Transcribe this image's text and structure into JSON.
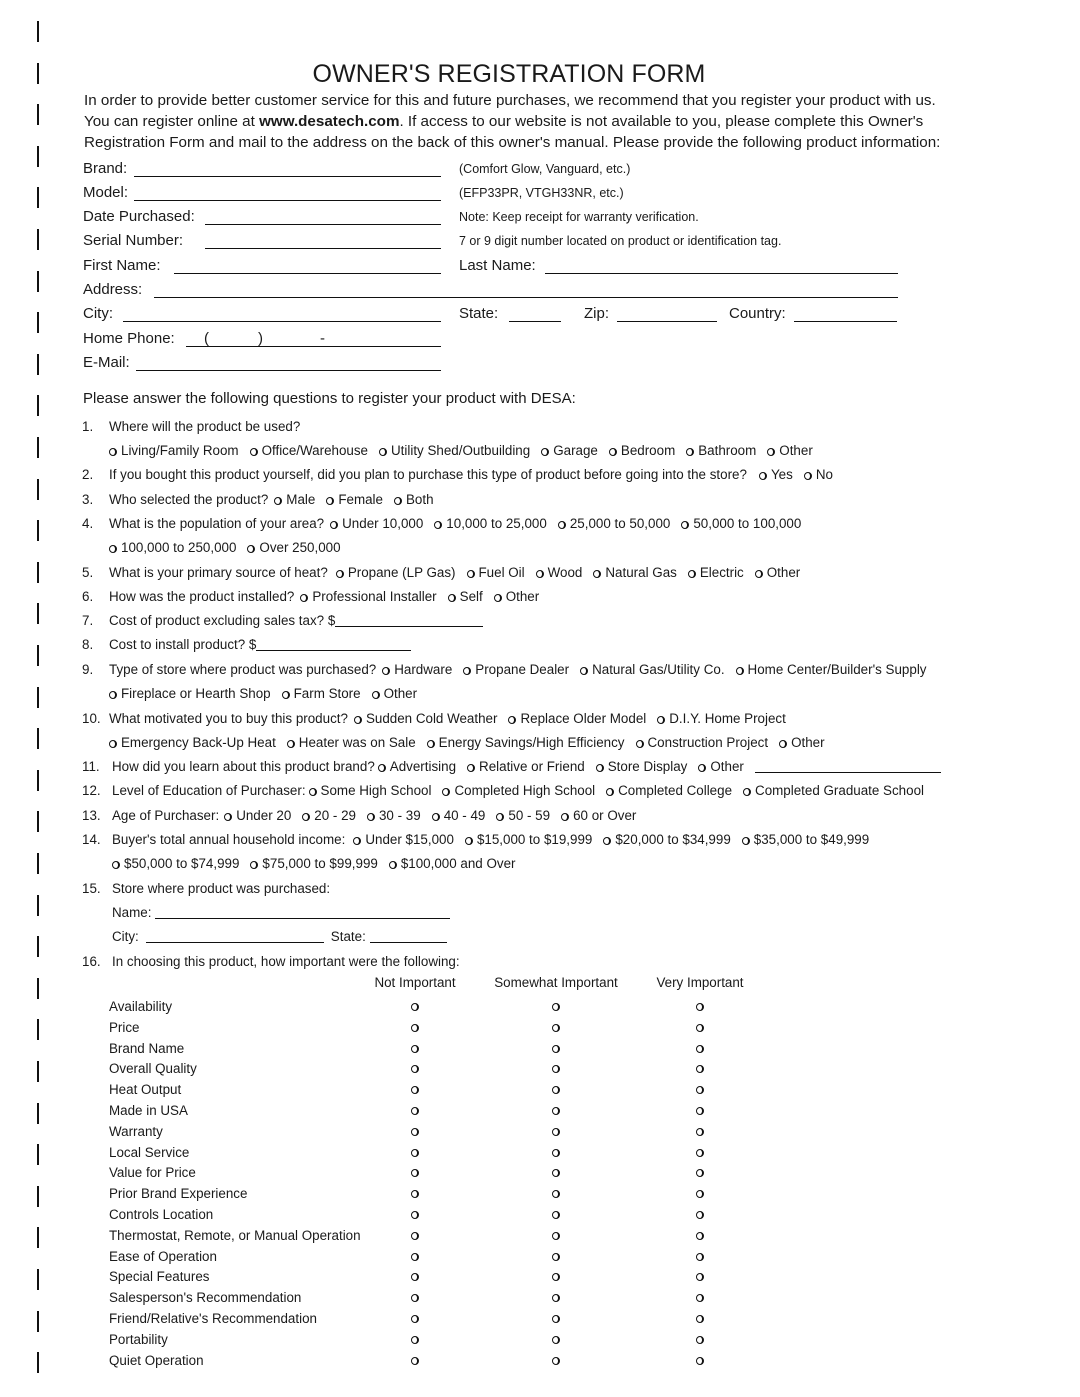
{
  "title": "OWNER'S REGISTRATION FORM",
  "intro": {
    "line1": "In order to provide better customer service for this and future purchases, we recommend that you register your product with us.",
    "line2_pre": "You can register online at ",
    "website": "www.desatech.com",
    "line2_post": ". If access to our website is not available to you, please complete this Owner's",
    "line3": "Registration Form and mail to the address on the back of this owner's manual. Please provide the following product information:"
  },
  "product_fields": {
    "brand": {
      "label": "Brand:",
      "hint": "(Comfort Glow, Vanguard, etc.)",
      "value": ""
    },
    "model": {
      "label": "Model:",
      "hint": "(EFP33PR, VTGH33NR, etc.)",
      "value": ""
    },
    "date_purchased": {
      "label": "Date Purchased:",
      "hint": "Note: Keep receipt for warranty verification.",
      "value": ""
    },
    "serial_number": {
      "label": "Serial Number:",
      "hint": "7 or 9 digit number located on product or identification tag.",
      "value": ""
    },
    "first_name": {
      "label": "First Name:",
      "value": ""
    },
    "last_name": {
      "label": "Last Name:",
      "value": ""
    },
    "address": {
      "label": "Address:",
      "value": ""
    },
    "city": {
      "label": "City:",
      "value": ""
    },
    "state": {
      "label": "State:",
      "value": ""
    },
    "zip": {
      "label": "Zip:",
      "value": ""
    },
    "country": {
      "label": "Country:",
      "value": ""
    },
    "home_phone": {
      "label": "Home Phone:",
      "open_paren": "(",
      "close_paren": ")",
      "dash": "-",
      "value": ""
    },
    "email": {
      "label": "E-Mail:",
      "value": ""
    }
  },
  "questions_intro": "Please answer the following questions to register your product with DESA:",
  "questions": [
    {
      "num": "1.",
      "text": "Where will the product be used?",
      "options": [
        "Living/Family Room",
        "Office/Warehouse",
        "Utility Shed/Outbuilding",
        "Garage",
        "Bedroom",
        "Bathroom",
        "Other"
      ]
    },
    {
      "num": "2.",
      "text": "If you bought this product yourself, did you plan to purchase this type of product before going into the store?",
      "options": [
        "Yes",
        "No"
      ]
    },
    {
      "num": "3.",
      "text": "Who selected the product?",
      "options": [
        "Male",
        "Female",
        "Both"
      ]
    },
    {
      "num": "4.",
      "text": "What is the population of your area?",
      "options": [
        "Under 10,000",
        "10,000 to 25,000",
        "25,000 to 50,000",
        "50,000 to 100,000",
        "100,000 to 250,000",
        "Over 250,000"
      ]
    },
    {
      "num": "5.",
      "text": "What is your primary source of heat?",
      "options": [
        "Propane (LP Gas)",
        "Fuel Oil",
        "Wood",
        "Natural Gas",
        "Electric",
        "Other"
      ]
    },
    {
      "num": "6.",
      "text": "How was the product installed?",
      "options": [
        "Professional Installer",
        "Self",
        "Other"
      ]
    },
    {
      "num": "7.",
      "text": "Cost of product excluding sales tax? $",
      "value": ""
    },
    {
      "num": "8.",
      "text": "Cost to install product? $",
      "value": ""
    },
    {
      "num": "9.",
      "text": "Type of store where product was purchased?",
      "options": [
        "Hardware",
        "Propane Dealer",
        "Natural Gas/Utility Co.",
        "Home Center/Builder's Supply",
        "Fireplace or Hearth Shop",
        "Farm Store",
        "Other"
      ]
    },
    {
      "num": "10.",
      "text": "What motivated you to buy this product?",
      "options": [
        "Sudden Cold Weather",
        "Replace Older Model",
        "D.I.Y. Home Project",
        "Emergency Back-Up Heat",
        "Heater was on Sale",
        "Energy Savings/High Efficiency",
        "Construction Project",
        "Other"
      ]
    },
    {
      "num": "11.",
      "text": "How did you learn about this product brand?",
      "options": [
        "Advertising",
        "Relative or Friend",
        "Store Display",
        "Other"
      ],
      "other_value": ""
    },
    {
      "num": "12.",
      "text": "Level of Education of Purchaser:",
      "options": [
        "Some High School",
        "Completed High School",
        "Completed College",
        "Completed Graduate School"
      ]
    },
    {
      "num": "13.",
      "text": "Age of Purchaser:",
      "options": [
        "Under 20",
        "20 - 29",
        "30 - 39",
        "40 - 49",
        "50 - 59",
        "60 or Over"
      ]
    },
    {
      "num": "14.",
      "text": "Buyer's total annual household income:",
      "options": [
        "Under $15,000",
        "$15,000 to $19,999",
        "$20,000 to $34,999",
        "$35,000 to $49,999",
        "$50,000 to $74,999",
        "$75,000 to $99,999",
        "$100,000 and Over"
      ]
    },
    {
      "num": "15.",
      "text": "Store where product was purchased:",
      "fields": {
        "name_label": "Name:",
        "city_label": "City:",
        "state_label": "State:",
        "name_value": "",
        "city_value": "",
        "state_value": ""
      }
    },
    {
      "num": "16.",
      "text": "In choosing this product, how important were the following:"
    }
  ],
  "importance": {
    "columns": [
      "Not Important",
      "Somewhat Important",
      "Very Important"
    ],
    "factors": [
      "Availability",
      "Price",
      "Brand Name",
      "Overall Quality",
      "Heat Output",
      "Made in USA",
      "Warranty",
      "Local Service",
      "Value for Price",
      "Prior Brand Experience",
      "Controls Location",
      "Thermostat, Remote, or Manual Operation",
      "Ease of Operation",
      "Special Features",
      "Salesperson's Recommendation",
      "Friend/Relative's Recommendation",
      "Portability",
      "Quiet Operation"
    ]
  }
}
